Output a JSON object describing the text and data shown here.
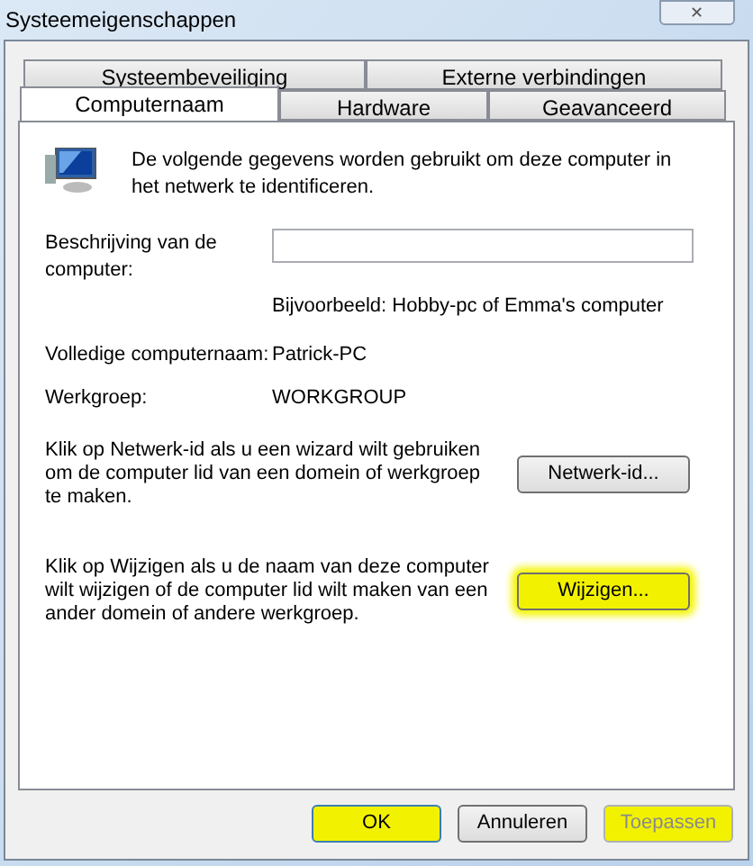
{
  "window": {
    "title": "Systeemeigenschappen",
    "close_label": "✕"
  },
  "tab_rows": [
    [
      {
        "label": "Systeembeveiliging",
        "selected": false
      },
      {
        "label": "Externe verbindingen",
        "selected": false
      }
    ],
    [
      {
        "label": "Computernaam",
        "selected": true
      },
      {
        "label": "Hardware",
        "selected": false
      },
      {
        "label": "Geavanceerd",
        "selected": false
      }
    ]
  ],
  "intro": "De volgende gegevens worden gebruikt om deze computer in het netwerk te identificeren.",
  "description": {
    "label": "Beschrijving van de computer:",
    "hint": "Bijvoorbeeld: Hobby-pc of Emma's computer"
  },
  "info_rows": [
    {
      "label": "Volledige computernaam:",
      "value": "Patrick-PC"
    },
    {
      "label": "Werkgroep:",
      "value": "WORKGROUP"
    }
  ],
  "actions": [
    {
      "text": "Klik op Netwerk-id als u een wizard wilt gebruiken om de computer lid van een domein of werkgroep te maken.",
      "button": "Netwerk-id...",
      "highlighted": false
    },
    {
      "text": "Klik op Wijzigen als u de naam van deze computer wilt wijzigen of de computer lid wilt maken van een ander domein of andere werkgroep.",
      "button": "Wijzigen...",
      "highlighted": true
    }
  ],
  "buttons": [
    {
      "label": "OK",
      "default": true,
      "disabled": false,
      "highlighted": true
    },
    {
      "label": "Annuleren",
      "default": false,
      "disabled": false,
      "highlighted": false
    },
    {
      "label": "Toepassen",
      "default": false,
      "disabled": true,
      "highlighted": true
    }
  ]
}
